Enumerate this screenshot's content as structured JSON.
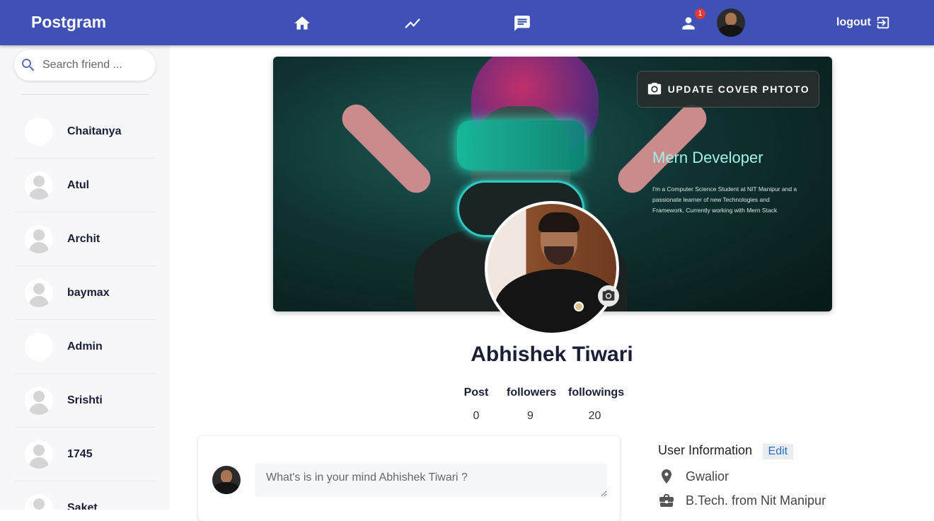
{
  "app": {
    "brand": "Postgram"
  },
  "nav": {
    "home_icon": "home-icon",
    "trending_icon": "trending-icon",
    "chat_icon": "chat-icon",
    "friend_requests_icon": "person-icon",
    "notification_count": "1",
    "logout_label": "logout",
    "logout_icon": "logout-icon",
    "accent": "#3f51b5"
  },
  "sidebar": {
    "search_placeholder": "Search friend ...",
    "friends": [
      {
        "name": "Chaitanya",
        "avatar": "photo-green"
      },
      {
        "name": "Atul",
        "avatar": "default"
      },
      {
        "name": "Archit",
        "avatar": "default"
      },
      {
        "name": "baymax",
        "avatar": "default"
      },
      {
        "name": "Admin",
        "avatar": "photo-group"
      },
      {
        "name": "Srishti",
        "avatar": "default"
      },
      {
        "name": "1745",
        "avatar": "default"
      },
      {
        "name": "Saket",
        "avatar": "default"
      }
    ]
  },
  "cover": {
    "update_button": "UPDATE COVER PHTOTO",
    "title": "Mern Developer",
    "description": "I'm a Computer Science Student at NIT Manipur and a passionate learner of new Technologies and Framework, Currently working with Mern Stack"
  },
  "profile": {
    "name": "Abhishek Tiwari",
    "stats": [
      {
        "label": "Post",
        "value": "0"
      },
      {
        "label": "followers",
        "value": "9"
      },
      {
        "label": "followings",
        "value": "20"
      }
    ]
  },
  "composer": {
    "placeholder": "What's is in your mind Abhishek Tiwari ?"
  },
  "user_info": {
    "title": "User Information",
    "edit_label": "Edit",
    "location": "Gwalior",
    "education": "B.Tech. from Nit Manipur"
  }
}
